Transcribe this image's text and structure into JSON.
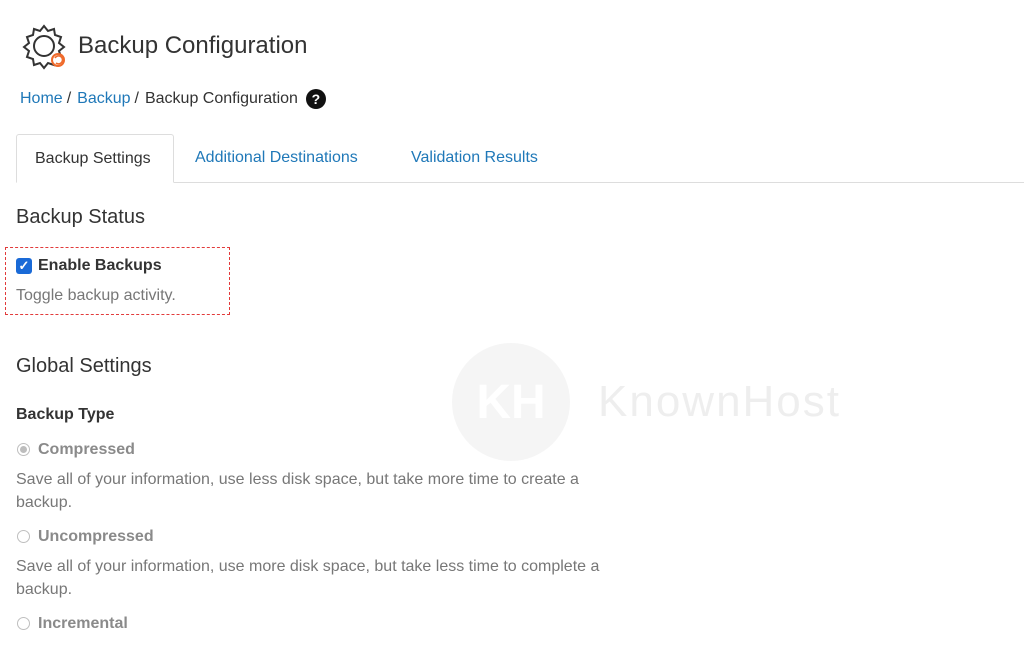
{
  "header": {
    "title": "Backup Configuration",
    "icon": "backup-gear-icon"
  },
  "breadcrumb": {
    "home": "Home",
    "backup": "Backup",
    "current": "Backup Configuration",
    "help_icon": "?"
  },
  "tabs": [
    {
      "label": "Backup Settings",
      "active": true
    },
    {
      "label": "Additional Destinations",
      "active": false
    },
    {
      "label": "Validation Results",
      "active": false
    }
  ],
  "backup_status": {
    "title": "Backup Status",
    "enable_label": "Enable Backups",
    "enable_checked": true,
    "enable_help": "Toggle backup activity."
  },
  "global_settings": {
    "title": "Global Settings",
    "backup_type_label": "Backup Type",
    "options": [
      {
        "label": "Compressed",
        "checked": true,
        "help_line1": "Save all of your information, use less disk space, but take more time to create a",
        "help_line2": "backup."
      },
      {
        "label": "Uncompressed",
        "checked": false,
        "help_line1": "Save all of your information, use more disk space, but take less time to complete a",
        "help_line2": "backup."
      },
      {
        "label": "Incremental",
        "checked": false
      }
    ]
  },
  "watermark": {
    "brand": "KnownHost",
    "mark": "KH"
  },
  "colors": {
    "link": "#1f78b8",
    "checkbox": "#1a6ad7",
    "highlight_border": "#e23b3b"
  }
}
